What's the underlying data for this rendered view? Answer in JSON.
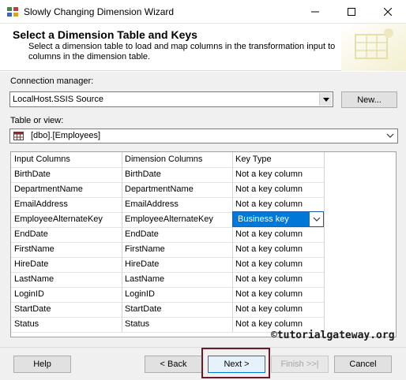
{
  "window": {
    "title": "Slowly Changing Dimension Wizard",
    "controls": {
      "minimize": "minimize-icon",
      "maximize": "maximize-icon",
      "close": "close-icon"
    }
  },
  "header": {
    "title": "Select a Dimension Table and Keys",
    "description": "Select a dimension table to load and map columns in the transformation input to columns in the dimension table."
  },
  "connection": {
    "label": "Connection manager:",
    "value": "LocalHost.SSIS Source",
    "new_button": "New..."
  },
  "table": {
    "label": "Table or view:",
    "value": "[dbo].[Employees]",
    "icon": "table-icon"
  },
  "grid": {
    "headers": [
      "Input Columns",
      "Dimension Columns",
      "Key Type"
    ],
    "rows": [
      [
        "BirthDate",
        "BirthDate",
        "Not a key column"
      ],
      [
        "DepartmentName",
        "DepartmentName",
        "Not a key column"
      ],
      [
        "EmailAddress",
        "EmailAddress",
        "Not a key column"
      ],
      [
        "EmployeeAlternateKey",
        "EmployeeAlternateKey",
        "Business key"
      ],
      [
        "EndDate",
        "EndDate",
        "Not a key column"
      ],
      [
        "FirstName",
        "FirstName",
        "Not a key column"
      ],
      [
        "HireDate",
        "HireDate",
        "Not a key column"
      ],
      [
        "LastName",
        "LastName",
        "Not a key column"
      ],
      [
        "LoginID",
        "LoginID",
        "Not a key column"
      ],
      [
        "StartDate",
        "StartDate",
        "Not a key column"
      ],
      [
        "Status",
        "Status",
        "Not a key column"
      ]
    ],
    "selected_row": 3
  },
  "watermark": "©tutorialgateway.org",
  "buttons": {
    "help": "Help",
    "back": "< Back",
    "next": "Next >",
    "finish": "Finish >>|",
    "cancel": "Cancel"
  },
  "colors": {
    "selection": "#0078d7",
    "highlight_border": "#6b1a2a",
    "panel": "#f0f0f0"
  }
}
